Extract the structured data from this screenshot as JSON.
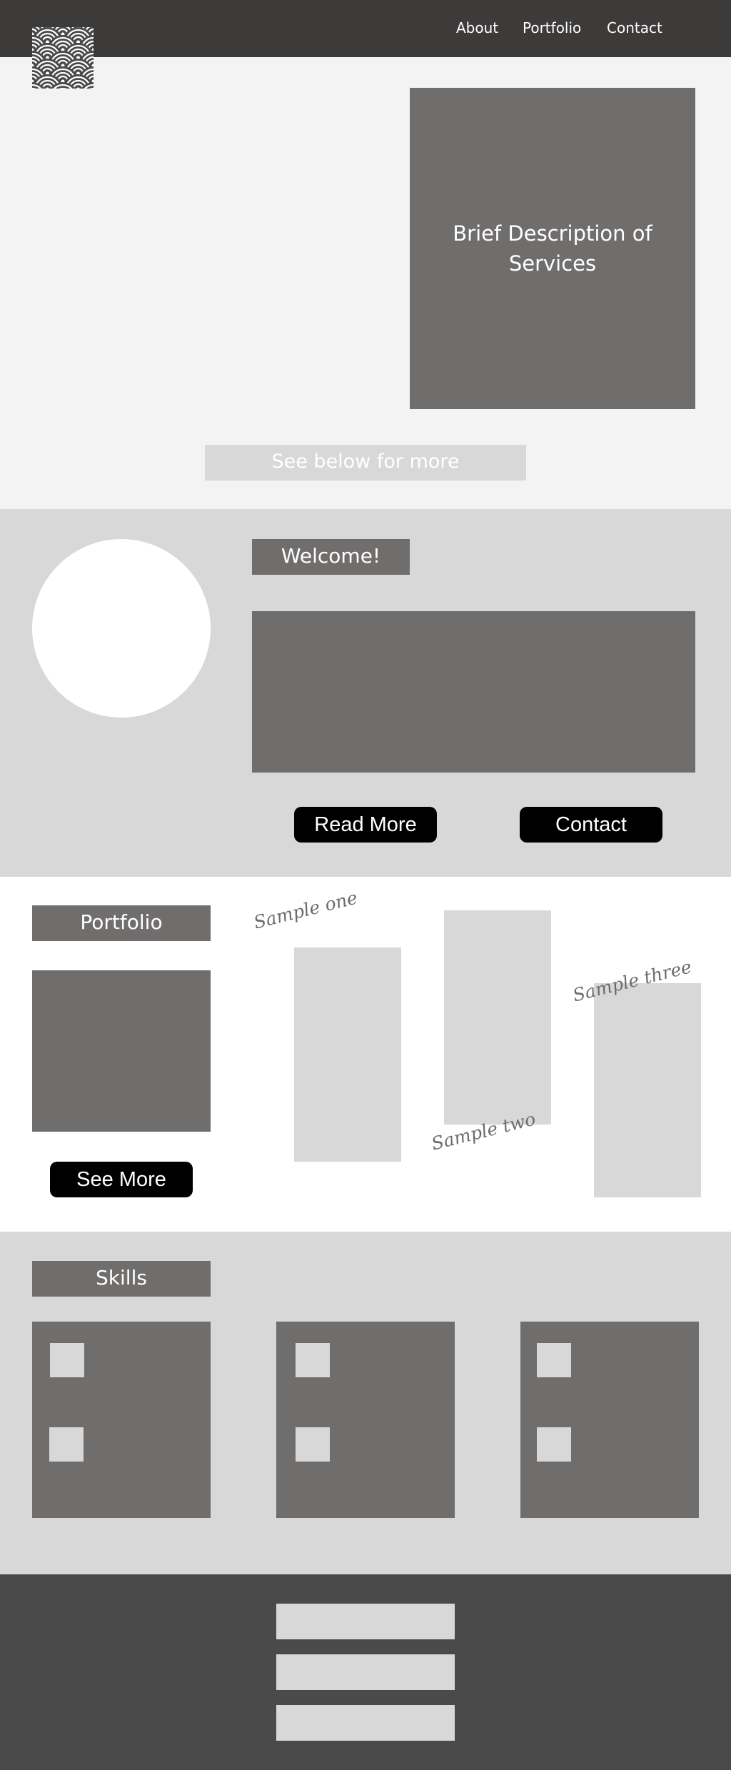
{
  "nav": {
    "links": [
      "About",
      "Portfolio",
      "Contact"
    ]
  },
  "hero": {
    "description": "Brief Description of Services",
    "see_below": "See below for more"
  },
  "about": {
    "welcome": "Welcome!",
    "read_more": "Read More",
    "contact": "Contact"
  },
  "portfolio": {
    "heading": "Portfolio",
    "see_more": "See More",
    "samples": [
      "Sample one",
      "Sample two",
      "Sample three"
    ]
  },
  "skills": {
    "heading": "Skills"
  },
  "colors": {
    "nav_bg": "#3d3a3a",
    "dark_panel": "#706d6d",
    "light_panel": "#d8d8d8",
    "hero_bg": "#f3f3f3",
    "footer_bg": "#4a4a4a",
    "button_bg": "#000000"
  },
  "icons": {
    "logo": "seigaiha-wave-logo"
  }
}
